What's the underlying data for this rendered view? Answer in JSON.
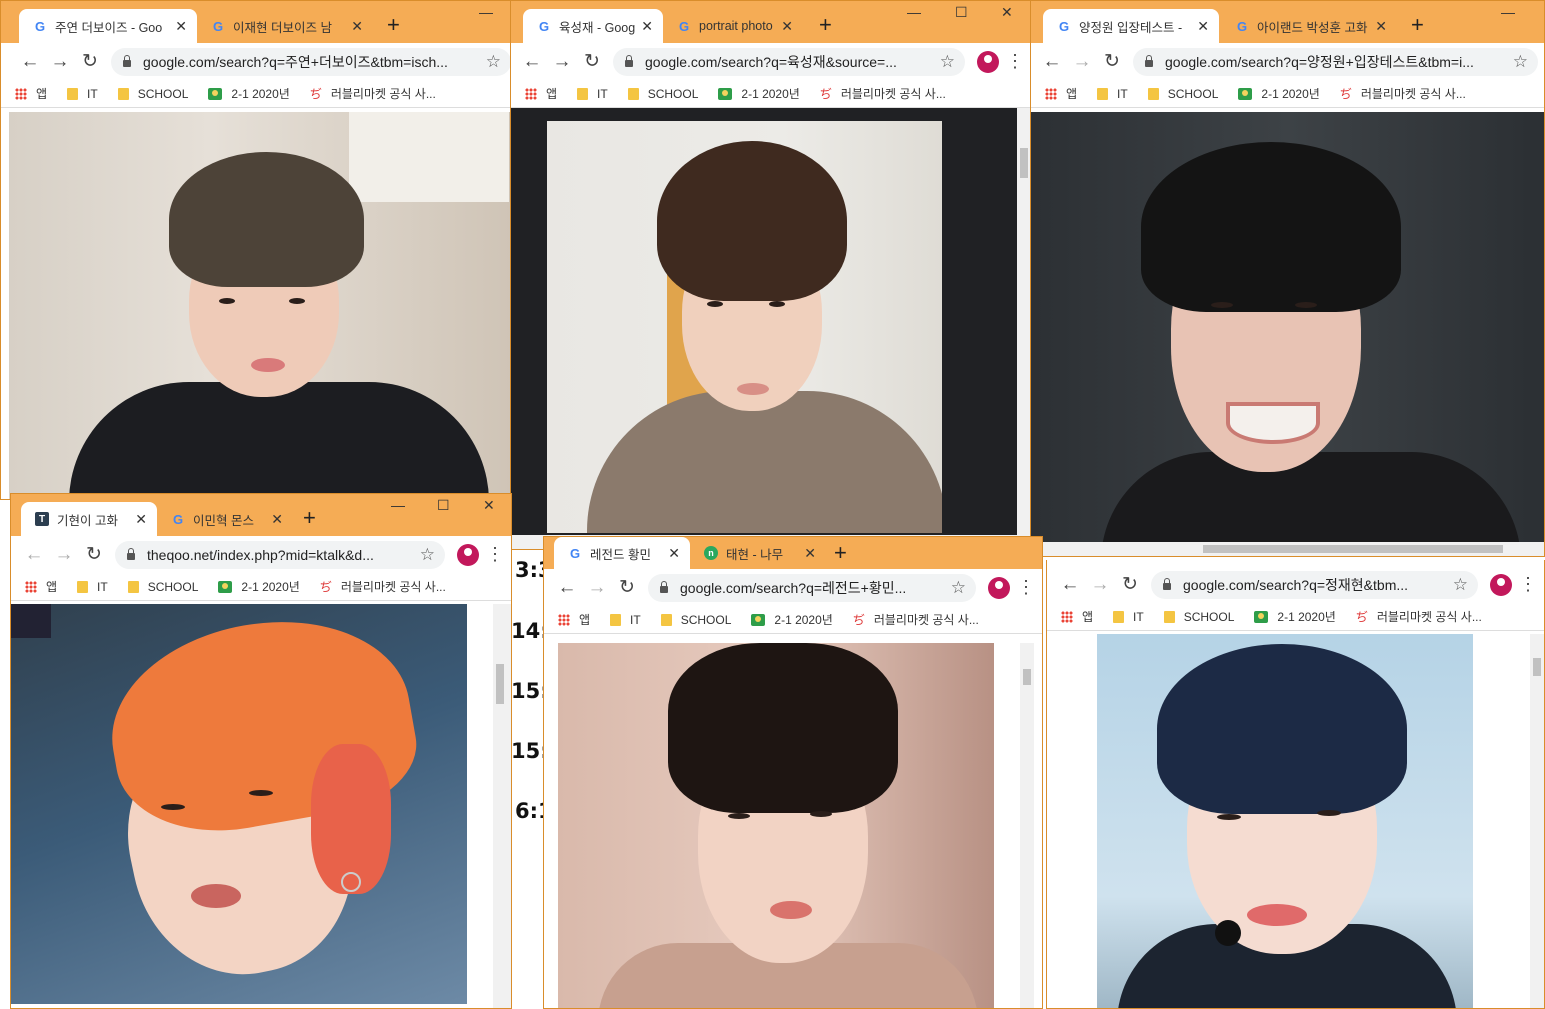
{
  "background_times": [
    "3:3",
    "14:",
    "15:",
    "15:",
    "6:1"
  ],
  "windows": [
    {
      "id": "w1",
      "tabs": [
        {
          "label": "주연 더보이즈 - Goo",
          "favicon": "G"
        },
        {
          "label": "이재현 더보이즈 남",
          "favicon": "G"
        }
      ],
      "url": "google.com/search?q=주연+더보이즈&tbm=isch...",
      "bookmarks": [
        "앱",
        "IT",
        "SCHOOL",
        "2-1 2020년",
        "러블리마켓 공식 사..."
      ]
    },
    {
      "id": "w2",
      "tabs": [
        {
          "label": "육성재 - Goog",
          "favicon": "G"
        },
        {
          "label": "portrait photo",
          "favicon": "G"
        }
      ],
      "url": "google.com/search?q=육성재&source=...",
      "bookmarks": [
        "앱",
        "IT",
        "SCHOOL",
        "2-1 2020년",
        "러블리마켓 공식 사..."
      ]
    },
    {
      "id": "w3",
      "tabs": [
        {
          "label": "양정원 입장테스트 -",
          "favicon": "G"
        },
        {
          "label": "아이랜드 박성훈 고화",
          "favicon": "G"
        }
      ],
      "url": "google.com/search?q=양정원+입장테스트&tbm=i...",
      "bookmarks": [
        "앱",
        "IT",
        "SCHOOL",
        "2-1 2020년",
        "러블리마켓 공식 사..."
      ]
    },
    {
      "id": "w4",
      "tabs": [
        {
          "label": "기현이 고화",
          "favicon": "T"
        },
        {
          "label": "이민혁 몬스",
          "favicon": "G"
        }
      ],
      "url": "theqoo.net/index.php?mid=ktalk&d...",
      "bookmarks": [
        "앱",
        "IT",
        "SCHOOL",
        "2-1 2020년",
        "러블리마켓 공식 사..."
      ]
    },
    {
      "id": "w5",
      "tabs": [
        {
          "label": "레전드 황민",
          "favicon": "G"
        },
        {
          "label": "태현 - 나무",
          "favicon": "N"
        }
      ],
      "url": "google.com/search?q=레전드+황민...",
      "bookmarks": [
        "앱",
        "IT",
        "SCHOOL",
        "2-1 2020년",
        "러블리마켓 공식 사..."
      ]
    },
    {
      "id": "w6",
      "tabs": [],
      "url": "google.com/search?q=정재현&tbm...",
      "bookmarks": [
        "앱",
        "IT",
        "SCHOOL",
        "2-1 2020년",
        "러블리마켓 공식 사..."
      ]
    }
  ],
  "icons": {
    "back": "arrow-left-icon",
    "forward": "arrow-right-icon",
    "reload": "reload-icon",
    "lock": "lock-icon",
    "star": "star-icon",
    "profile": "avatar",
    "menu": "kebab-menu-icon",
    "new_tab": "plus-icon",
    "close": "close-icon",
    "minimize": "minimize-icon",
    "maximize": "maximize-icon"
  },
  "colors": {
    "tab_strip": "#f5ac55",
    "active_tab": "#ffffff",
    "omnibox": "#f1f3f4"
  }
}
